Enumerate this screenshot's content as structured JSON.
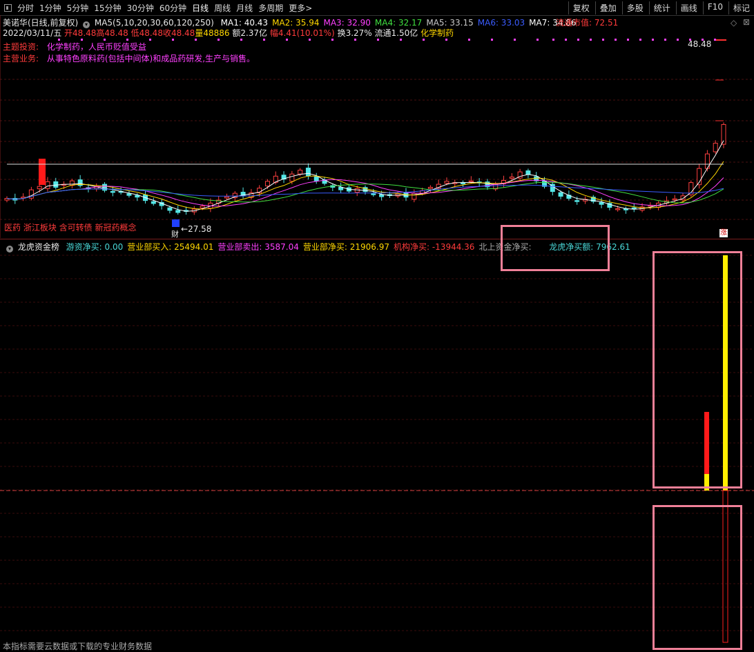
{
  "toolbar": {
    "tabs": [
      "分时",
      "1分钟",
      "5分钟",
      "15分钟",
      "30分钟",
      "60分钟",
      "日线",
      "周线",
      "月线",
      "多周期",
      "更多>"
    ],
    "active_tab": "日线",
    "right_buttons": [
      "复权",
      "叠加",
      "多股",
      "统计",
      "画线",
      "F10",
      "标记"
    ]
  },
  "header": {
    "stock_title": "美诺华(日线,前复权)",
    "ma_param": "MA5(5,10,20,30,60,120,250)",
    "ma": [
      {
        "label": "MA1:",
        "value": "40.43",
        "color": "#ffffff"
      },
      {
        "label": "MA2:",
        "value": "35.94",
        "color": "#ffd700"
      },
      {
        "label": "MA3:",
        "value": "32.90",
        "color": "#ff40ff"
      },
      {
        "label": "MA4:",
        "value": "32.17",
        "color": "#40e040"
      },
      {
        "label": "MA5:",
        "value": "33.15",
        "color": "#c8c8c8"
      },
      {
        "label": "MA6:",
        "value": "33.03",
        "color": "#3a5cff"
      },
      {
        "label": "MA7:",
        "value": "34.86",
        "color": "#ffffff"
      }
    ],
    "market_cap": "流通市值: 72.51",
    "date": "2022/03/11/五",
    "open": "开48.48",
    "high": "高48.48",
    "low": "低48.48",
    "close": "收48.48",
    "volume": "量48886",
    "amount": "额2.37亿",
    "change": "幅4.41(10.01%)",
    "turnover": "换3.27%",
    "float": "流通1.50亿",
    "industry": "化学制药",
    "theme_label": "主题投资:",
    "theme_value": "化学制药，人民币贬值受益",
    "business_label": "主营业务:",
    "business_value": "从事特色原料药(包括中间体)和成品药研发,生产与销售。",
    "price_top": "48.48"
  },
  "chart_data": {
    "type": "candlestick",
    "low_label": "27.58",
    "finance_marker": "财",
    "limit_up_marker": "涨",
    "concepts": "医药 浙江板块 含可转债 新冠药概念",
    "closes": [
      31.2,
      30.8,
      31.5,
      33.2,
      34.0,
      35.1,
      33.8,
      34.5,
      35.3,
      34.2,
      33.5,
      34.0,
      33.1,
      32.6,
      32.8,
      31.9,
      31.5,
      30.7,
      30.0,
      29.5,
      28.4,
      27.9,
      28.3,
      28.7,
      29.4,
      30.1,
      30.8,
      31.6,
      32.4,
      31.9,
      32.5,
      33.6,
      35.2,
      36.4,
      35.7,
      36.9,
      37.8,
      36.5,
      35.3,
      34.7,
      33.8,
      33.2,
      32.9,
      33.5,
      32.8,
      32.1,
      31.6,
      32.0,
      32.3,
      31.5,
      32.4,
      33.0,
      33.8,
      34.5,
      35.2,
      34.9,
      34.6,
      35.3,
      34.8,
      33.9,
      34.6,
      35.4,
      36.2,
      37.4,
      36.8,
      35.3,
      34.0,
      32.8,
      31.7,
      31.2,
      30.6,
      31.0,
      30.5,
      29.8,
      29.1,
      28.8,
      28.5,
      28.7,
      29.2,
      29.6,
      30.1,
      30.6,
      31.1,
      31.8,
      34.9,
      38.2,
      41.6,
      44.1,
      48.48
    ],
    "volume_bars": [
      {
        "label": "sell",
        "value": "3587.04"
      },
      {
        "label": "buy",
        "value": "25494.01"
      }
    ]
  },
  "indicator": {
    "name": "龙虎资金榜",
    "items": [
      {
        "label": "游资净买:",
        "value": "0.00",
        "color": "#4ad8d8"
      },
      {
        "label": "营业部买入:",
        "value": "25494.01",
        "color": "#ffd700"
      },
      {
        "label": "营业部卖出:",
        "value": "3587.04",
        "color": "#ff40ff"
      },
      {
        "label": "营业部净买:",
        "value": "21906.97",
        "color": "#ffd700"
      },
      {
        "label": "机构净买:",
        "value": "-13944.36",
        "color": "#ff3b3b"
      },
      {
        "label": "北上资金净买:",
        "value": "",
        "color": "#aaaaaa"
      },
      {
        "label": "龙虎净买额:",
        "value": "7962.61",
        "color": "#4ad8d8"
      }
    ]
  },
  "footer_note": "本指标需要云数据或下载的专业财务数据"
}
